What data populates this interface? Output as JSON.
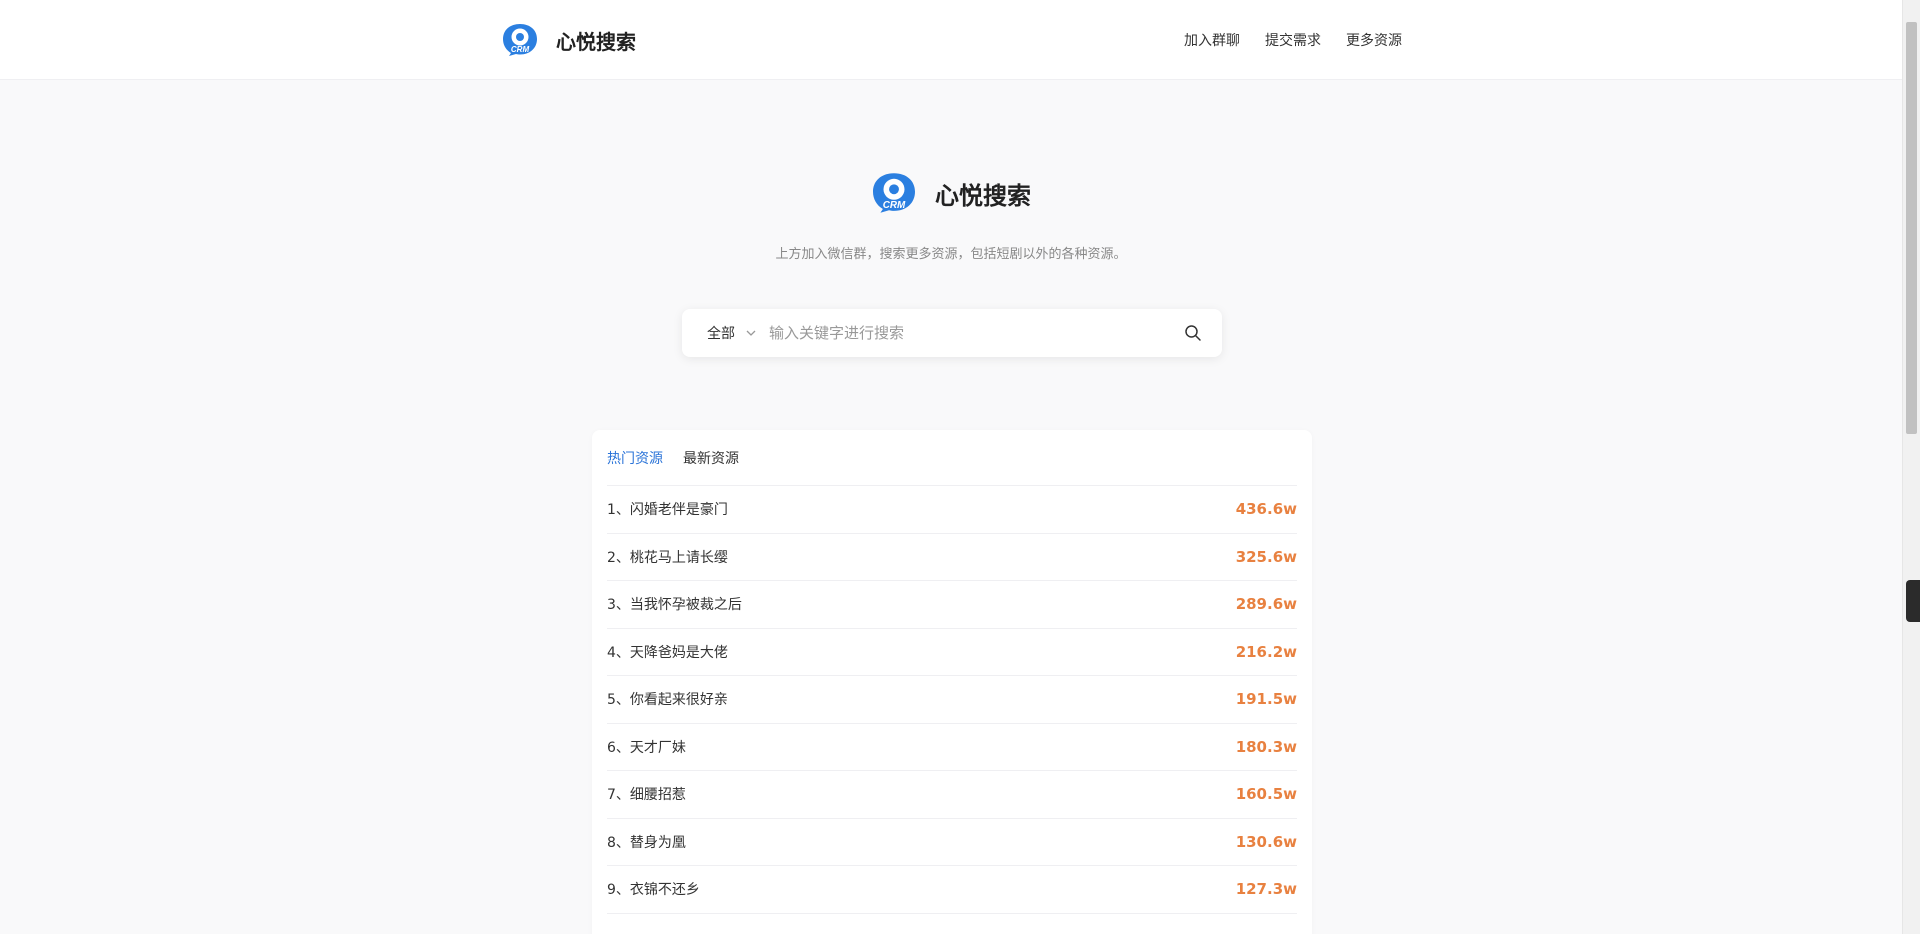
{
  "header": {
    "brand_name": "心悦搜索",
    "logo_text": "CRM",
    "nav": [
      "加入群聊",
      "提交需求",
      "更多资源"
    ]
  },
  "hero": {
    "brand_name": "心悦搜索",
    "logo_text": "CRM",
    "tagline": "上方加入微信群，搜索更多资源，包括短剧以外的各种资源。"
  },
  "search": {
    "category": "全部",
    "placeholder": "输入关键字进行搜索",
    "value": ""
  },
  "tabs": [
    {
      "label": "热门资源",
      "active": true
    },
    {
      "label": "最新资源",
      "active": false
    }
  ],
  "list": [
    {
      "title": "1、闪婚老伴是豪门",
      "count": "436.6w"
    },
    {
      "title": "2、桃花马上请长缨",
      "count": "325.6w"
    },
    {
      "title": "3、当我怀孕被裁之后",
      "count": "289.6w"
    },
    {
      "title": "4、天降爸妈是大佬",
      "count": "216.2w"
    },
    {
      "title": "5、你看起来很好亲",
      "count": "191.5w"
    },
    {
      "title": "6、天才厂妹",
      "count": "180.3w"
    },
    {
      "title": "7、细腰招惹",
      "count": "160.5w"
    },
    {
      "title": "8、替身为凰",
      "count": "130.6w"
    },
    {
      "title": "9、衣锦不还乡",
      "count": "127.3w"
    }
  ],
  "colors": {
    "accent": "#2b74d8",
    "count": "#e88140",
    "logo": "#2b7fe0"
  }
}
